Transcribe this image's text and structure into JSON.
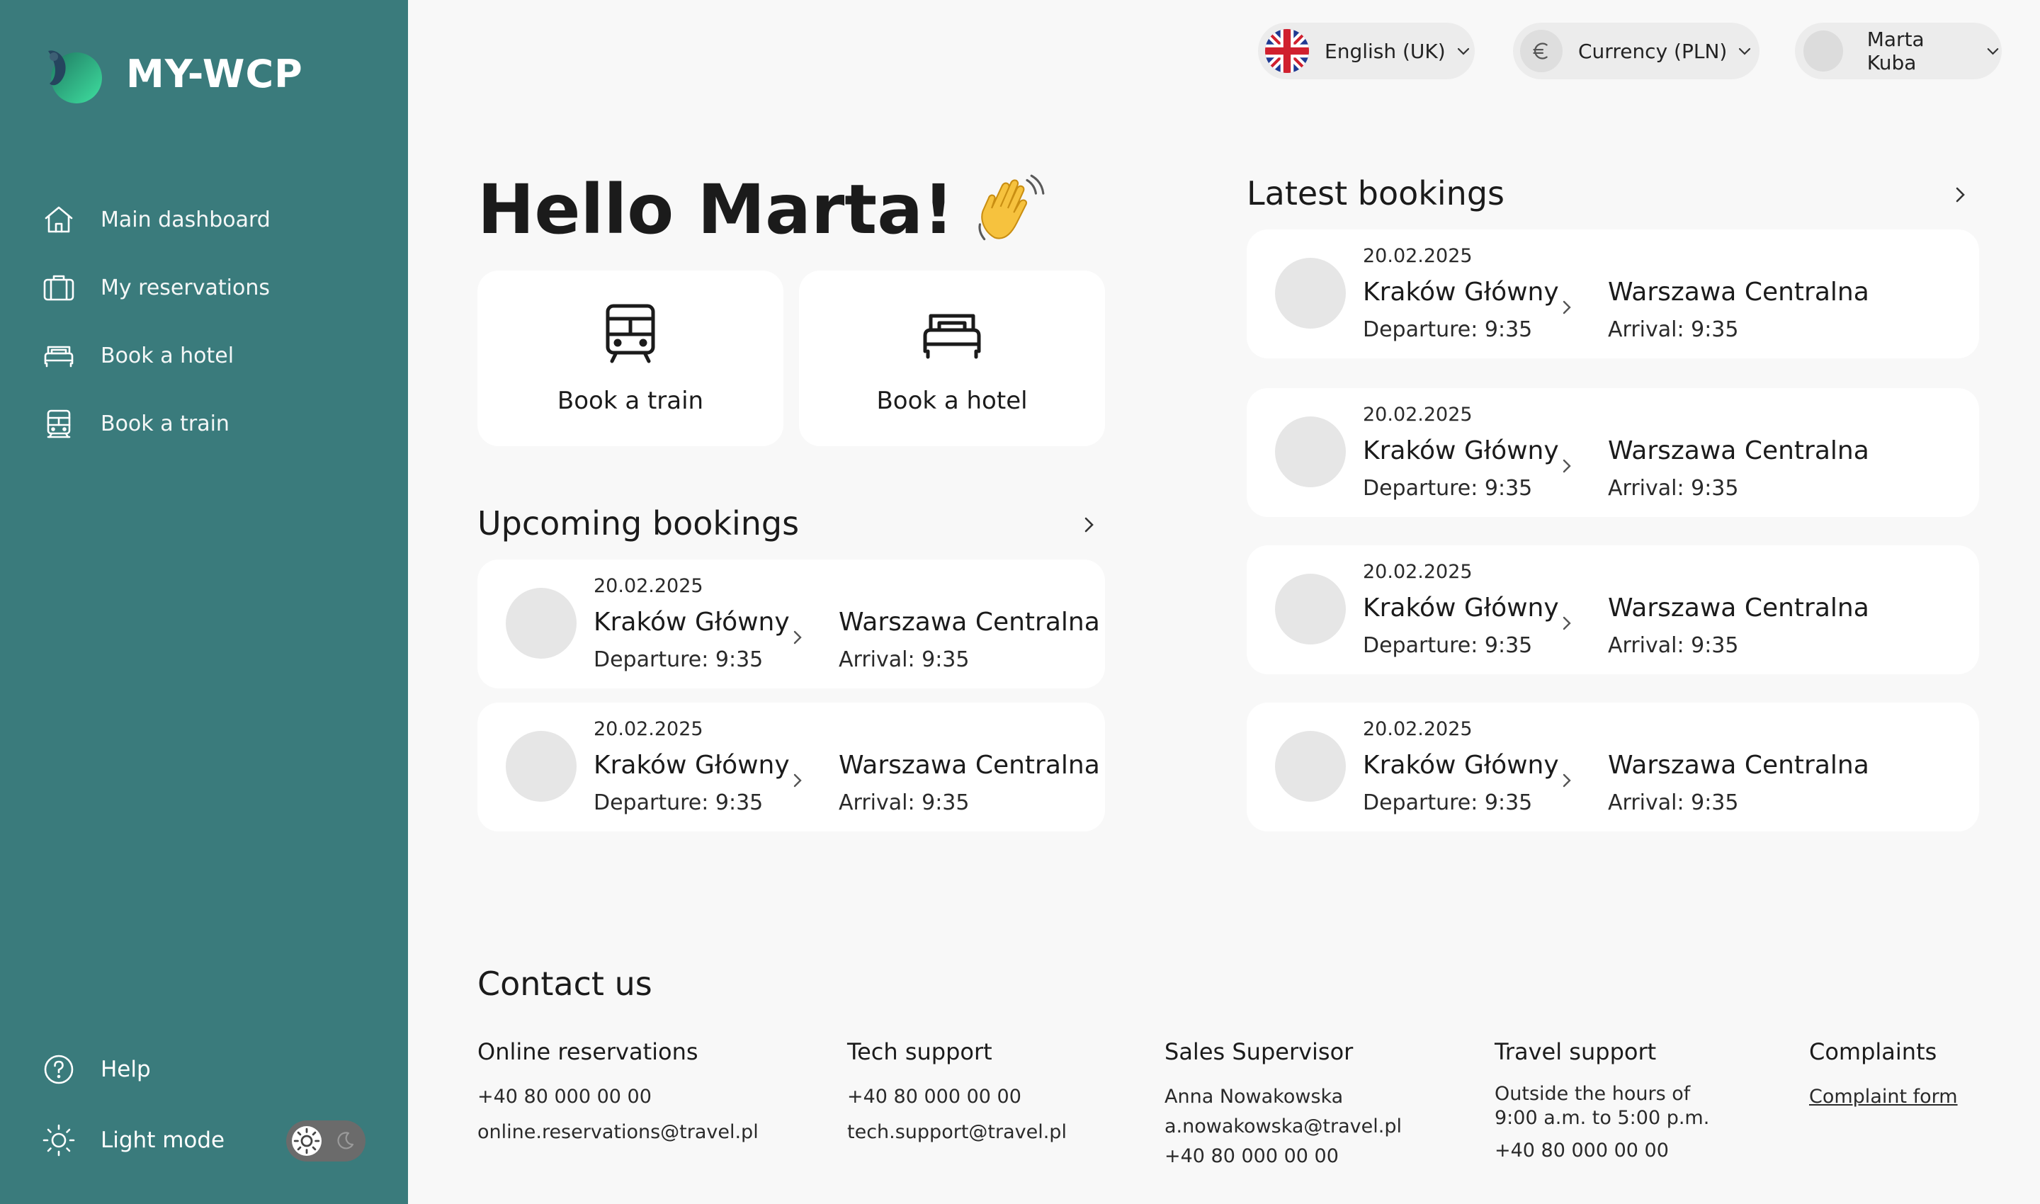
{
  "app": {
    "title": "MY-WCP"
  },
  "sidebar": {
    "items": [
      {
        "label": "Main dashboard",
        "icon": "home-icon"
      },
      {
        "label": "My reservations",
        "icon": "luggage-icon"
      },
      {
        "label": "Book a hotel",
        "icon": "bed-icon"
      },
      {
        "label": "Book a train",
        "icon": "train-icon"
      }
    ],
    "help_label": "Help",
    "mode_label": "Light mode"
  },
  "topbar": {
    "language_label": "English (UK)",
    "currency_label": "Currency (PLN)",
    "user_name": "Marta Kuba"
  },
  "greeting": {
    "text": "Hello Marta!"
  },
  "quick_actions": {
    "train_label": "Book a train",
    "hotel_label": "Book a hotel"
  },
  "upcoming": {
    "title": "Upcoming bookings",
    "bookings": [
      {
        "date": "20.02.2025",
        "from": "Kraków Główny",
        "departure": "Departure: 9:35",
        "to": "Warszawa Centralna",
        "arrival": "Arrival: 9:35"
      },
      {
        "date": "20.02.2025",
        "from": "Kraków Główny",
        "departure": "Departure: 9:35",
        "to": "Warszawa Centralna",
        "arrival": "Arrival: 9:35"
      }
    ]
  },
  "latest": {
    "title": "Latest bookings",
    "bookings": [
      {
        "date": "20.02.2025",
        "from": "Kraków Główny",
        "departure": "Departure: 9:35",
        "to": "Warszawa Centralna",
        "arrival": "Arrival: 9:35"
      },
      {
        "date": "20.02.2025",
        "from": "Kraków Główny",
        "departure": "Departure: 9:35",
        "to": "Warszawa Centralna",
        "arrival": "Arrival: 9:35"
      },
      {
        "date": "20.02.2025",
        "from": "Kraków Główny",
        "departure": "Departure: 9:35",
        "to": "Warszawa Centralna",
        "arrival": "Arrival: 9:35"
      },
      {
        "date": "20.02.2025",
        "from": "Kraków Główny",
        "departure": "Departure: 9:35",
        "to": "Warszawa Centralna",
        "arrival": "Arrival: 9:35"
      }
    ]
  },
  "contact": {
    "title": "Contact us",
    "online": {
      "title": "Online reservations",
      "phone": "+40 80 000 00 00",
      "email": "online.reservations@travel.pl"
    },
    "tech": {
      "title": "Tech support",
      "phone": "+40 80 000 00 00",
      "email": "tech.support@travel.pl"
    },
    "sales": {
      "title": "Sales Supervisor",
      "name": "Anna Nowakowska",
      "email": "a.nowakowska@travel.pl",
      "phone": "+40 80 000 00 00"
    },
    "travel": {
      "title": "Travel support",
      "hours_line1": "Outside the hours of",
      "hours_line2": "9:00 a.m. to 5:00 p.m.",
      "phone": "+40 80 000 00 00"
    },
    "complaints": {
      "title": "Complaints",
      "link": "Complaint form"
    }
  },
  "colors": {
    "sidebar": "#3a7b7c",
    "background": "#f8f8f8",
    "card": "#ffffff"
  }
}
